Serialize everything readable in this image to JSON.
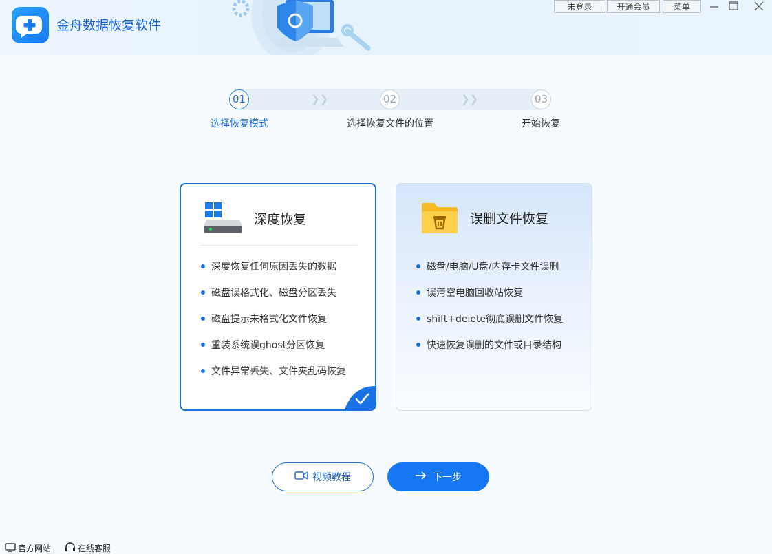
{
  "header": {
    "app_title": "金舟数据恢复软件",
    "login_label": "未登录",
    "vip_label": "开通会员",
    "menu_label": "菜单"
  },
  "steps": [
    {
      "num": "01",
      "label": "选择恢复模式"
    },
    {
      "num": "02",
      "label": "选择恢复文件的位置"
    },
    {
      "num": "03",
      "label": "开始恢复"
    }
  ],
  "cards": {
    "deep": {
      "title": "深度恢复",
      "features": [
        "深度恢复任何原因丢失的数据",
        "磁盘误格式化、磁盘分区丢失",
        "磁盘提示未格式化文件恢复",
        "重装系统误ghost分区恢复",
        "文件异常丢失、文件夹乱码恢复"
      ]
    },
    "deleted": {
      "title": "误删文件恢复",
      "features": [
        "磁盘/电脑/U盘/内存卡文件误删",
        "误清空电脑回收站恢复",
        "shift+delete彻底误删文件恢复",
        "快速恢复误删的文件或目录结构"
      ]
    }
  },
  "buttons": {
    "video": "视频教程",
    "next": "下一步"
  },
  "footer": {
    "website": "官方网站",
    "service": "在线客服"
  },
  "colors": {
    "accent": "#1677f2",
    "active_step": "#1f6fd6"
  }
}
